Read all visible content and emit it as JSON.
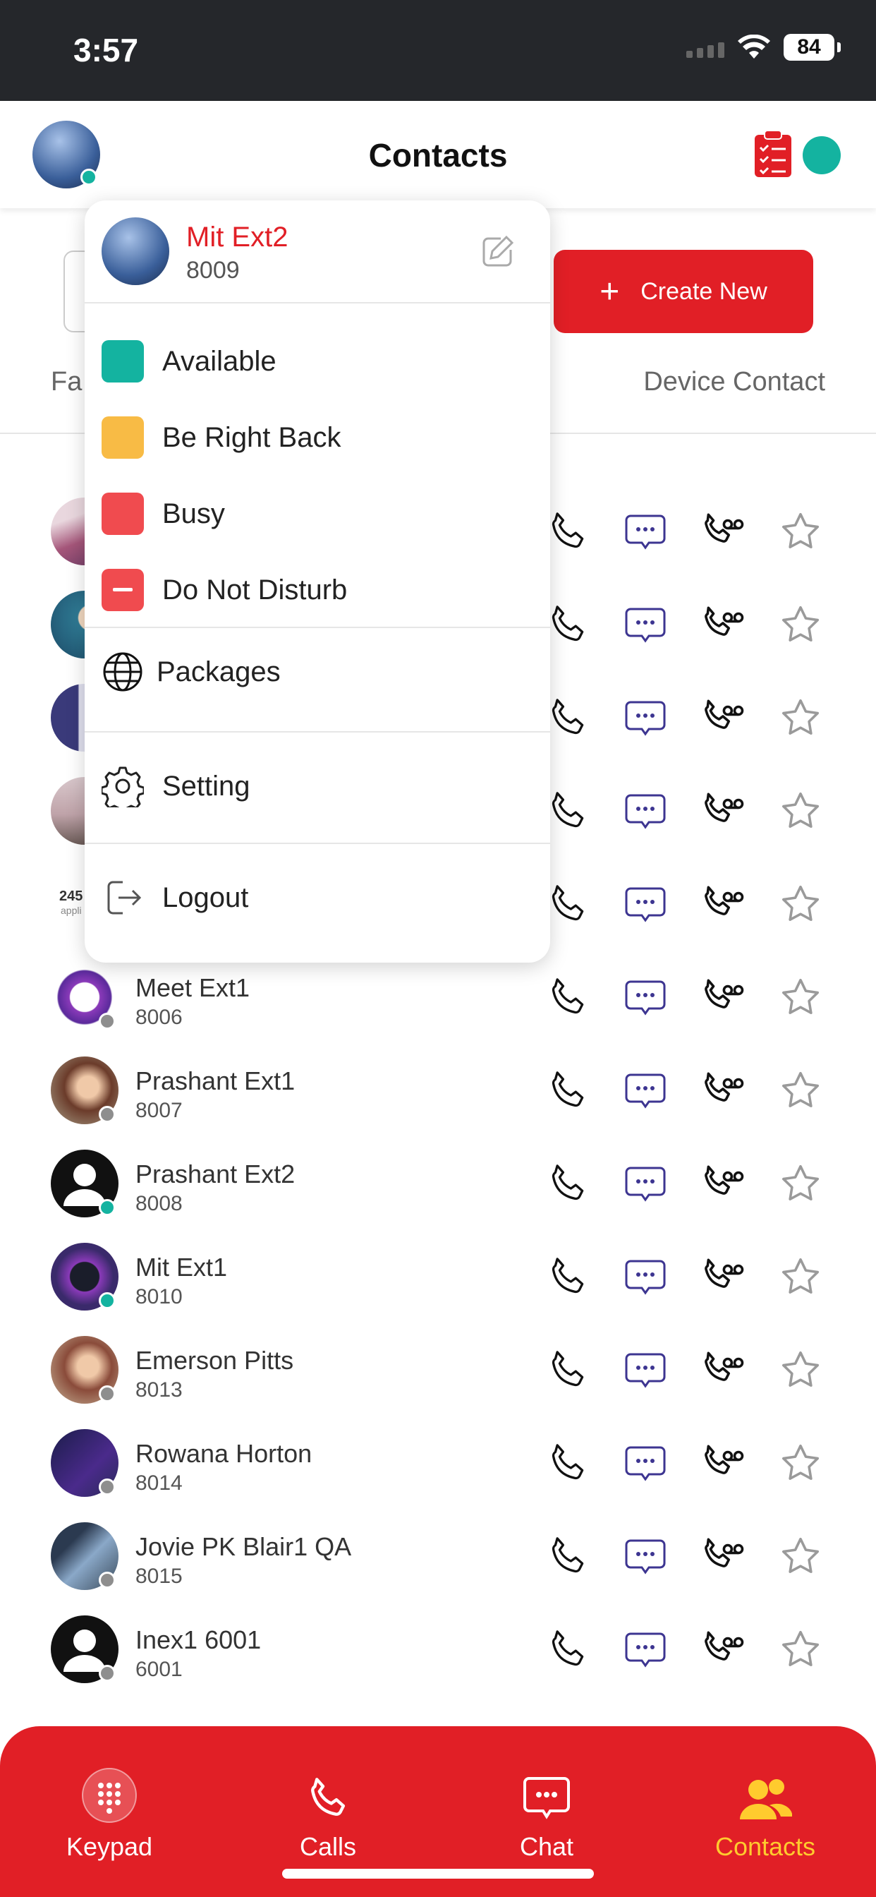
{
  "status_bar": {
    "time": "3:57",
    "battery": "84"
  },
  "header": {
    "title": "Contacts",
    "status_color": "#14b3a0"
  },
  "toolbar": {
    "create_label": "Create New",
    "plus": "+"
  },
  "tabs": {
    "left": "Fa",
    "right": "Device Contact"
  },
  "colors": {
    "brand_red": "#e11f26",
    "online": "#14b3a0",
    "offline": "#8e8e8e",
    "active_nav": "#ffcb2e",
    "action_purple": "#3d3591"
  },
  "popup": {
    "user_name": "Mit Ext2",
    "user_ext": "8009",
    "statuses": [
      {
        "label": "Available",
        "color": "#14b3a0"
      },
      {
        "label": "Be Right Back",
        "color": "#f8bb45"
      },
      {
        "label": "Busy",
        "color": "#f04b4f"
      },
      {
        "label": "Do Not Disturb",
        "color": "#f04b4f"
      }
    ],
    "packages": "Packages",
    "setting": "Setting",
    "logout": "Logout"
  },
  "contacts": [
    {
      "name": "",
      "ext": "",
      "status": "online"
    },
    {
      "name": "",
      "ext": "",
      "status": "online"
    },
    {
      "name": "",
      "ext": "",
      "status": "online"
    },
    {
      "name": "",
      "ext": "",
      "status": "online"
    },
    {
      "name": "",
      "ext": "",
      "status": "online"
    },
    {
      "name": "Meet Ext1",
      "ext": "8006",
      "status": "offline"
    },
    {
      "name": "Prashant Ext1",
      "ext": "8007",
      "status": "offline"
    },
    {
      "name": "Prashant Ext2",
      "ext": "8008",
      "status": "online"
    },
    {
      "name": "Mit Ext1",
      "ext": "8010",
      "status": "online"
    },
    {
      "name": "Emerson Pitts",
      "ext": "8013",
      "status": "offline"
    },
    {
      "name": "Rowana Horton",
      "ext": "8014",
      "status": "offline"
    },
    {
      "name": "Jovie PK Blair1 QA",
      "ext": "8015",
      "status": "offline"
    },
    {
      "name": "Inex1 6001",
      "ext": "6001",
      "status": "offline"
    }
  ],
  "avatar_text": {
    "line1": "245",
    "line2": "appli"
  },
  "nav": {
    "keypad": "Keypad",
    "calls": "Calls",
    "chat": "Chat",
    "contacts": "Contacts"
  }
}
